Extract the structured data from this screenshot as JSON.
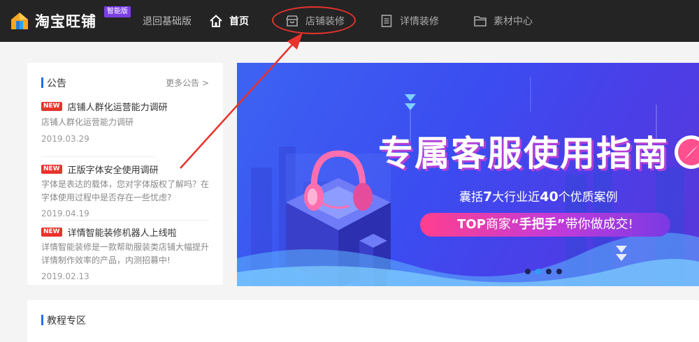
{
  "header": {
    "logo_text": "淘宝旺铺",
    "badge": "智能版",
    "back_link": "退回基础版",
    "nav": [
      {
        "label": "首页",
        "icon": "home-icon",
        "active": true
      },
      {
        "label": "店铺装修",
        "icon": "store-icon",
        "active": false
      },
      {
        "label": "详情装修",
        "icon": "document-icon",
        "active": false
      },
      {
        "label": "素材中心",
        "icon": "folder-icon",
        "active": false
      }
    ]
  },
  "notice": {
    "title": "公告",
    "more": "更多公告 >",
    "new_tag": "NEW",
    "items": [
      {
        "title": "店铺人群化运营能力调研",
        "desc": "店铺人群化运营能力调研",
        "date": "2019.03.29"
      },
      {
        "title": "正版字体安全使用调研",
        "desc": "字体是表达的载体，您对字体版权了解吗？在字体使用过程中是否存在一些忧虑?",
        "date": "2019.04.19"
      },
      {
        "title": "详情智能装修机器人上线啦",
        "desc": "详情智能装修是一款帮助服装类店铺大幅提升详情制作效率的产品，内测招募中!",
        "date": "2019.02.13"
      }
    ]
  },
  "banner": {
    "title": "专属客服使用指南",
    "sub_pre": "囊括",
    "sub_num1": "7",
    "sub_mid": "大行业近",
    "sub_num2": "40",
    "sub_post": "个优质案例",
    "pill_top": "TOP",
    "pill_merchant": "商家",
    "pill_quote": "“手把手”",
    "pill_post": "带你做成交!",
    "active_dot": 1,
    "dot_count": 4
  },
  "tutorial": {
    "title": "教程专区"
  },
  "colors": {
    "topbar": "#242424",
    "accent_blue": "#1e6ff3",
    "new_red": "#e8322c",
    "badge_purple": "#7b3fe4",
    "annotation_red": "#e8322c"
  }
}
